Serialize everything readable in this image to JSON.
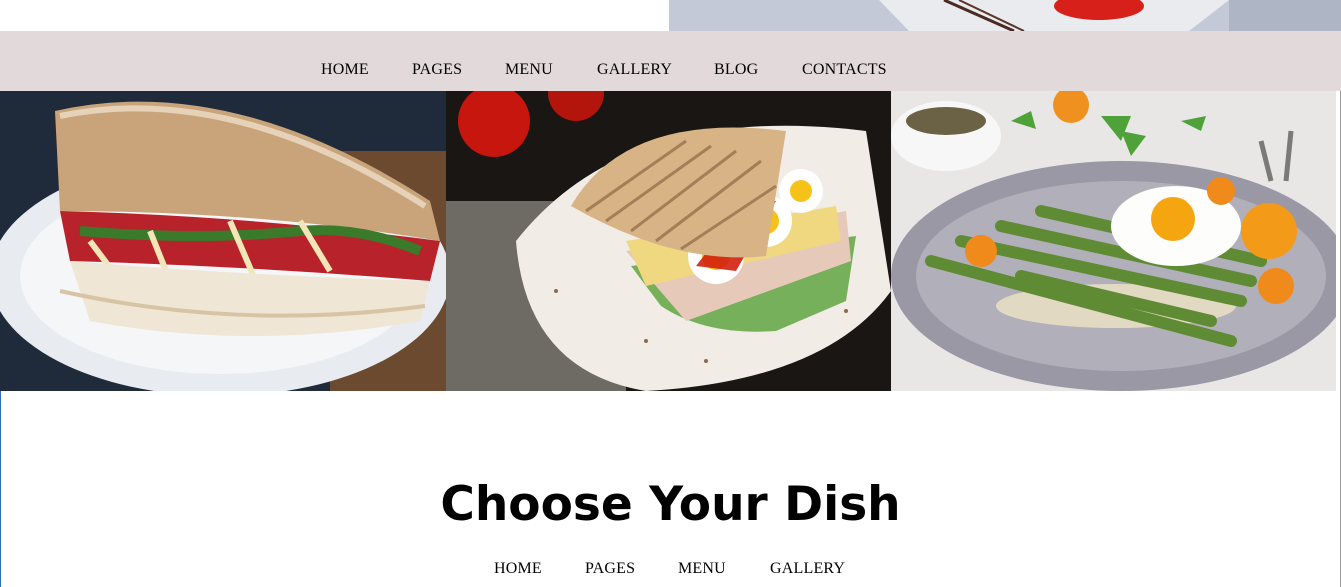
{
  "nav": {
    "items": [
      {
        "label": "HOME"
      },
      {
        "label": "PAGES"
      },
      {
        "label": "MENU"
      },
      {
        "label": "GALLERY"
      },
      {
        "label": "BLOG"
      },
      {
        "label": "CONTACTS"
      }
    ]
  },
  "section": {
    "title": "Choose Your Dish",
    "links": [
      {
        "label": "HOME"
      },
      {
        "label": "PAGES"
      },
      {
        "label": "MENU"
      },
      {
        "label": "GALLERY"
      }
    ]
  },
  "colors": {
    "nav_background": "#e2dada",
    "page_background": "#ffffff"
  },
  "images": [
    {
      "name": "ciabatta-sandwich-photo"
    },
    {
      "name": "grilled-panini-egg-photo"
    },
    {
      "name": "asparagus-fried-egg-photo"
    }
  ]
}
